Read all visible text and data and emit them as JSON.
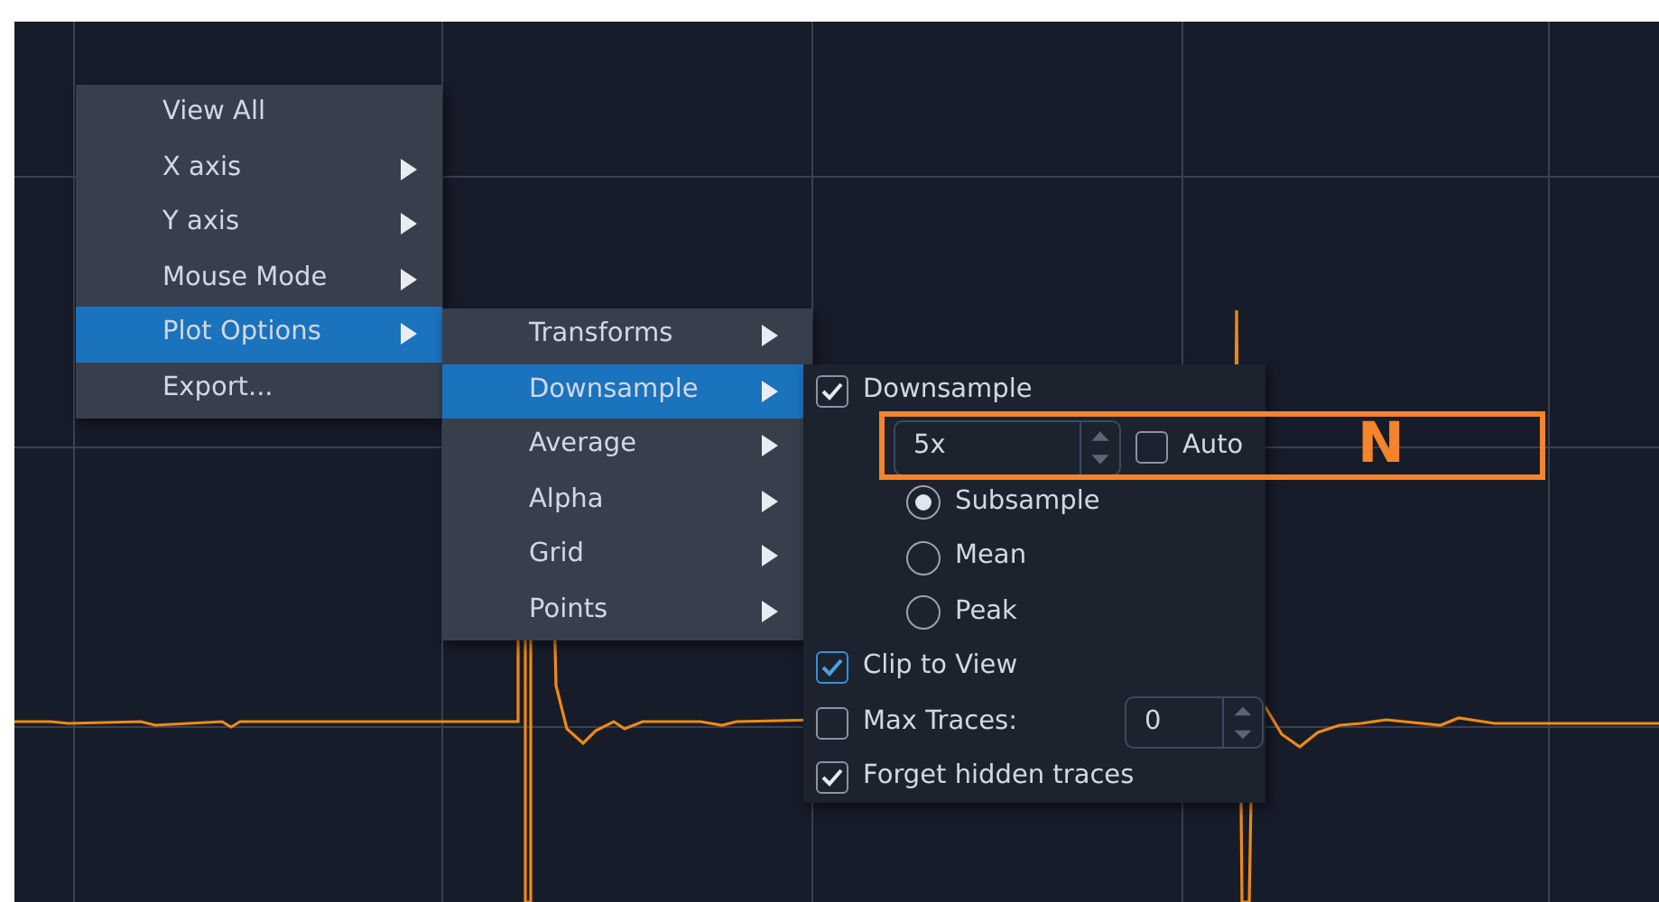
{
  "main_menu": {
    "items": [
      {
        "label": "View All",
        "submenu": false,
        "selected": false
      },
      {
        "label": "X axis",
        "submenu": true,
        "selected": false
      },
      {
        "label": "Y axis",
        "submenu": true,
        "selected": false
      },
      {
        "label": "Mouse Mode",
        "submenu": true,
        "selected": false
      },
      {
        "label": "Plot Options",
        "submenu": true,
        "selected": true
      },
      {
        "label": "Export...",
        "submenu": false,
        "selected": false
      }
    ]
  },
  "plot_options_menu": {
    "items": [
      {
        "label": "Transforms",
        "submenu": true,
        "selected": false
      },
      {
        "label": "Downsample",
        "submenu": true,
        "selected": true
      },
      {
        "label": "Average",
        "submenu": true,
        "selected": false
      },
      {
        "label": "Alpha",
        "submenu": true,
        "selected": false
      },
      {
        "label": "Grid",
        "submenu": true,
        "selected": false
      },
      {
        "label": "Points",
        "submenu": true,
        "selected": false
      }
    ]
  },
  "downsample_panel": {
    "downsample": {
      "label": "Downsample",
      "checked": true
    },
    "factor": {
      "value": "5x"
    },
    "auto": {
      "label": "Auto",
      "checked": false
    },
    "modes": [
      {
        "label": "Subsample",
        "selected": true
      },
      {
        "label": "Mean",
        "selected": false
      },
      {
        "label": "Peak",
        "selected": false
      }
    ],
    "clip_to_view": {
      "label": "Clip to View",
      "checked": true
    },
    "max_traces": {
      "label": "Max Traces:",
      "checked": false,
      "value": "0"
    },
    "forget_hidden_traces": {
      "label": "Forget hidden traces",
      "checked": true
    }
  },
  "annotation": {
    "text": "N"
  }
}
